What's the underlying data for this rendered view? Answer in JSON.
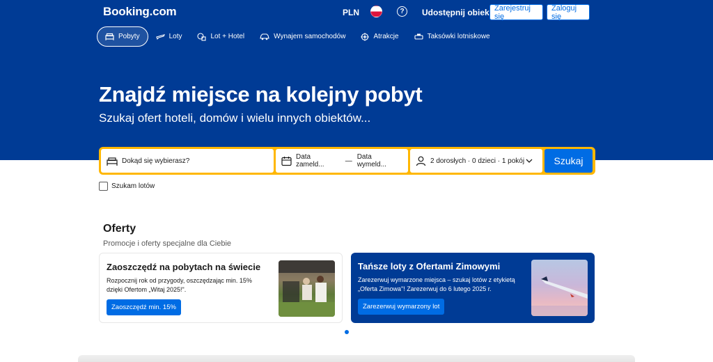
{
  "header": {
    "logo": "Booking.com",
    "currency": "PLN",
    "language_icon": "poland-flag-icon",
    "help_icon": "question-circle-icon",
    "list_property": "Udostępnij obiekt",
    "register": "Zarejestruj się",
    "login": "Zaloguj się"
  },
  "nav": [
    {
      "label": "Pobyty",
      "icon": "bed-icon",
      "active": true
    },
    {
      "label": "Loty",
      "icon": "plane-icon"
    },
    {
      "label": "Lot + Hotel",
      "icon": "flight-hotel-icon"
    },
    {
      "label": "Wynajem samochodów",
      "icon": "car-icon"
    },
    {
      "label": "Atrakcje",
      "icon": "attractions-icon"
    },
    {
      "label": "Taksówki lotniskowe",
      "icon": "taxi-icon"
    }
  ],
  "hero": {
    "title": "Znajdź miejsce na kolejny pobyt",
    "subtitle": "Szukaj ofert hoteli, domów i wielu innych obiektów..."
  },
  "search": {
    "destination_placeholder": "Dokąd się wybierasz?",
    "checkin": "Data zameld...",
    "separator": "—",
    "checkout": "Data wymeld...",
    "guests": "2 dorosłych · 0 dzieci · 1 pokój",
    "button": "Szukaj",
    "flights_checkbox": "Szukam lotów"
  },
  "offers": {
    "title": "Oferty",
    "subtitle": "Promocje i oferty specjalne dla Ciebie",
    "cards": [
      {
        "title": "Zaoszczędź na pobytach na świecie",
        "text": "Rozpocznij rok od przygody, oszczędzając min. 15% dzięki Ofertom „Witaj 2025!\".",
        "button": "Zaoszczędź min. 15%"
      },
      {
        "title": "Tańsze loty z Ofertami Zimowymi",
        "text": "Zarezerwuj wymarzone miejsca – szukaj lotów z etykietą „Oferta Zimowa\"! Zarezerwuj do 6 lutego 2025 r.",
        "button": "Zarezerwuj wymarzony lot"
      }
    ]
  },
  "colors": {
    "brand_blue": "#003b95",
    "accent_blue": "#006ce4",
    "search_border": "#ffb700"
  }
}
